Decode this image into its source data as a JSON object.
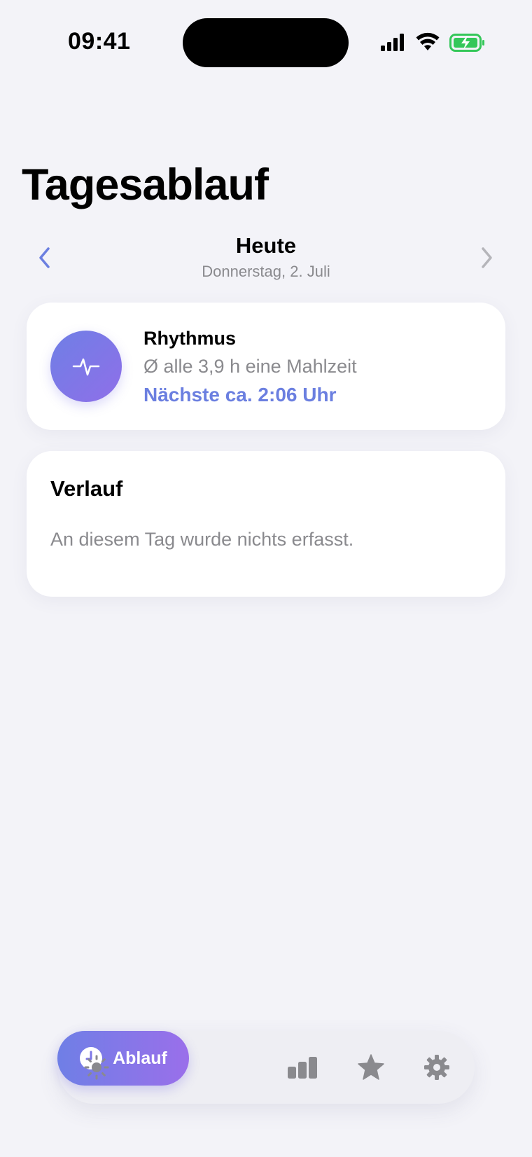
{
  "status_bar": {
    "time": "09:41",
    "icons": [
      "cellular-signal-icon",
      "wifi-icon",
      "battery-charging-icon"
    ],
    "battery_color": "#34c759"
  },
  "page": {
    "title": "Tagesablauf"
  },
  "day_nav": {
    "title": "Heute",
    "subtitle": "Donnerstag, 2. Juli",
    "prev_icon": "chevron-left-icon",
    "next_icon": "chevron-right-icon"
  },
  "rhythm_card": {
    "icon": "waveform-pulse-icon",
    "title": "Rhythmus",
    "average": "Ø alle 3,9 h eine Mahlzeit",
    "next": "Nächste ca. 2:06 Uhr"
  },
  "history_card": {
    "title": "Verlauf",
    "empty_text": "An diesem Tag wurde nichts erfasst."
  },
  "tab_bar": {
    "tabs": [
      {
        "icon": "sun-icon",
        "label": ""
      },
      {
        "icon": "clock-icon",
        "label": "Ablauf"
      },
      {
        "icon": "bar-chart-icon",
        "label": ""
      },
      {
        "icon": "star-icon",
        "label": ""
      },
      {
        "icon": "gear-icon",
        "label": ""
      }
    ],
    "active_index": 1
  },
  "colors": {
    "accent": "#6b7fe0",
    "accent_gradient_start": "#6f7fe6",
    "accent_gradient_end": "#9a6fea",
    "background": "#f3f3f8",
    "secondary_text": "#8a8a8e",
    "inactive_icon": "#8a8a8e"
  }
}
